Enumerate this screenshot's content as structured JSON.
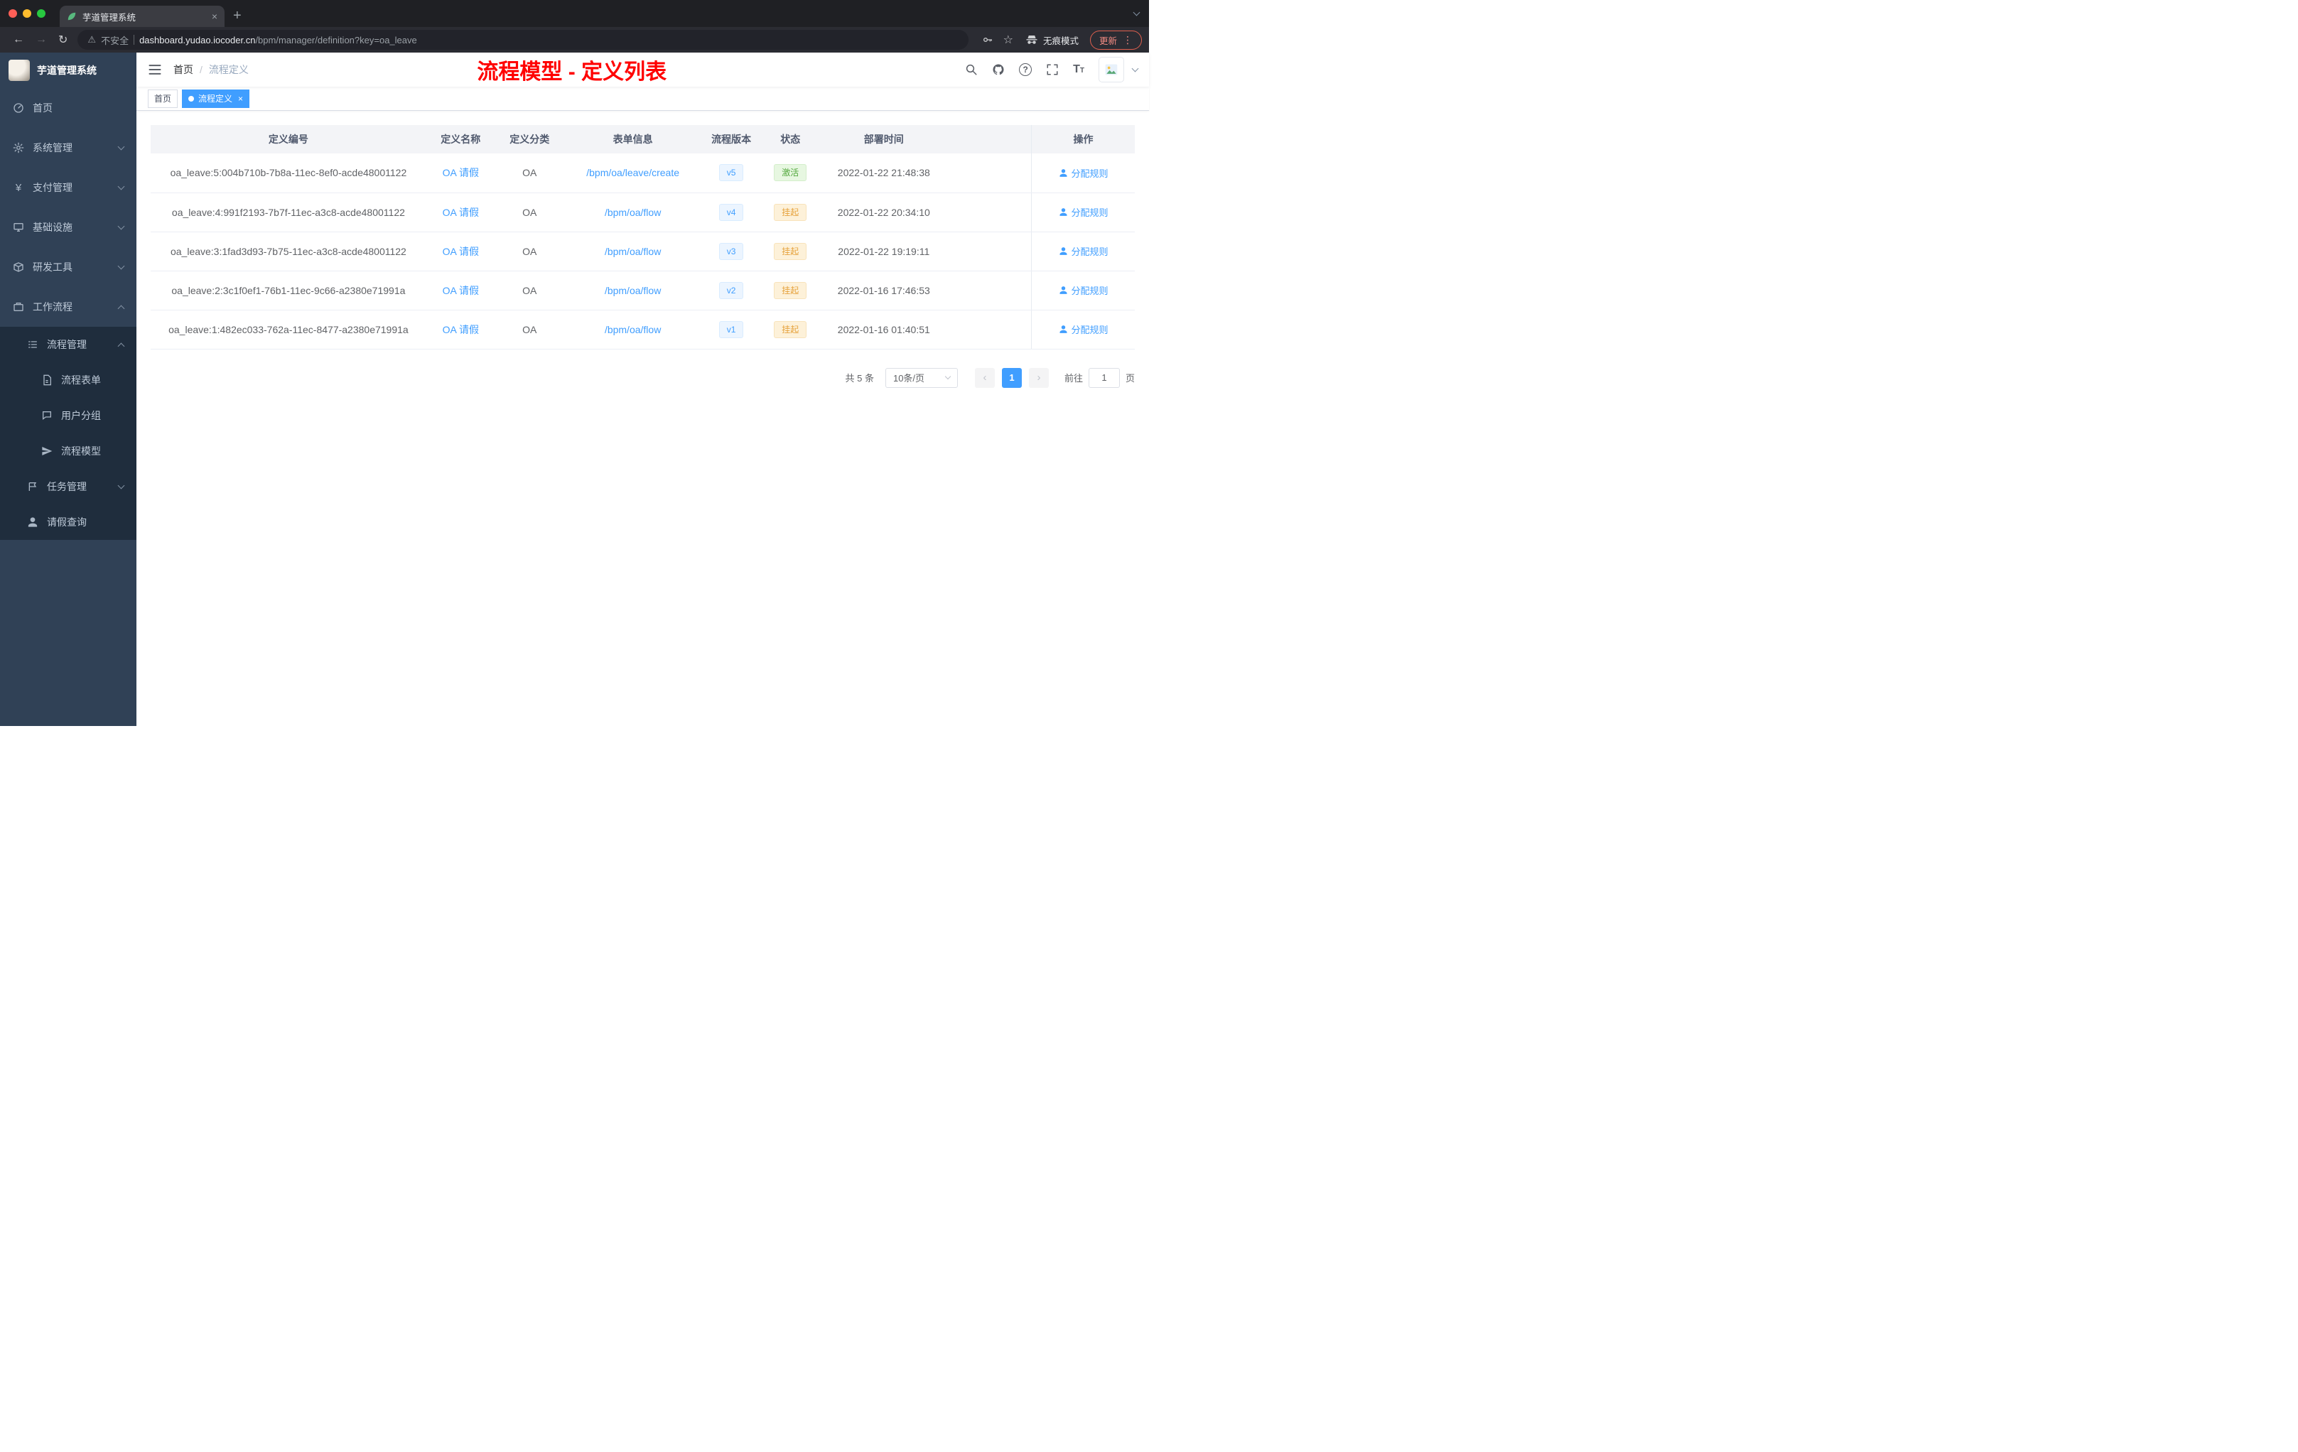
{
  "browser": {
    "tab_title": "芋道管理系统",
    "security_label": "不安全",
    "url_domain": "dashboard.yudao.iocoder.cn",
    "url_path": "/bpm/manager/definition?key=oa_leave",
    "incognito_label": "无痕模式",
    "update_label": "更新"
  },
  "sidebar": {
    "logo_title": "芋道管理系统",
    "items": [
      {
        "label": "首页"
      },
      {
        "label": "系统管理"
      },
      {
        "label": "支付管理"
      },
      {
        "label": "基础设施"
      },
      {
        "label": "研发工具"
      },
      {
        "label": "工作流程"
      },
      {
        "label": "流程管理"
      },
      {
        "label": "流程表单"
      },
      {
        "label": "用户分组"
      },
      {
        "label": "流程模型"
      },
      {
        "label": "任务管理"
      },
      {
        "label": "请假查询"
      }
    ]
  },
  "header": {
    "breadcrumb_home": "首页",
    "breadcrumb_sep": "/",
    "breadcrumb_current": "流程定义",
    "title": "流程模型 - 定义列表"
  },
  "tags": {
    "home": "首页",
    "active": "流程定义"
  },
  "table": {
    "columns": [
      "定义编号",
      "定义名称",
      "定义分类",
      "表单信息",
      "流程版本",
      "状态",
      "部署时间",
      "操作"
    ],
    "rows": [
      {
        "id": "oa_leave:5:004b710b-7b8a-11ec-8ef0-acde48001122",
        "name": "OA 请假",
        "category": "OA",
        "form": "/bpm/oa/leave/create",
        "version": "v5",
        "status": "激活",
        "status_type": "success",
        "time": "2022-01-22 21:48:38",
        "action": "分配规则"
      },
      {
        "id": "oa_leave:4:991f2193-7b7f-11ec-a3c8-acde48001122",
        "name": "OA 请假",
        "category": "OA",
        "form": "/bpm/oa/flow",
        "version": "v4",
        "status": "挂起",
        "status_type": "warning",
        "time": "2022-01-22 20:34:10",
        "action": "分配规则"
      },
      {
        "id": "oa_leave:3:1fad3d93-7b75-11ec-a3c8-acde48001122",
        "name": "OA 请假",
        "category": "OA",
        "form": "/bpm/oa/flow",
        "version": "v3",
        "status": "挂起",
        "status_type": "warning",
        "time": "2022-01-22 19:19:11",
        "action": "分配规则"
      },
      {
        "id": "oa_leave:2:3c1f0ef1-76b1-11ec-9c66-a2380e71991a",
        "name": "OA 请假",
        "category": "OA",
        "form": "/bpm/oa/flow",
        "version": "v2",
        "status": "挂起",
        "status_type": "warning",
        "time": "2022-01-16 17:46:53",
        "action": "分配规则"
      },
      {
        "id": "oa_leave:1:482ec033-762a-11ec-8477-a2380e71991a",
        "name": "OA 请假",
        "category": "OA",
        "form": "/bpm/oa/flow",
        "version": "v1",
        "status": "挂起",
        "status_type": "warning",
        "time": "2022-01-16 01:40:51",
        "action": "分配规则"
      }
    ]
  },
  "pagination": {
    "total": "共 5 条",
    "page_size": "10条/页",
    "current_page": "1",
    "goto_label": "前往",
    "goto_value": "1",
    "goto_unit": "页"
  },
  "colors": {
    "accent_blue": "#409eff",
    "success_green": "#53a83d",
    "warning_orange": "#e6a23c",
    "title_red": "#ff0000",
    "sidebar_bg": "#304156",
    "submenu_bg": "#1f2d3d"
  }
}
